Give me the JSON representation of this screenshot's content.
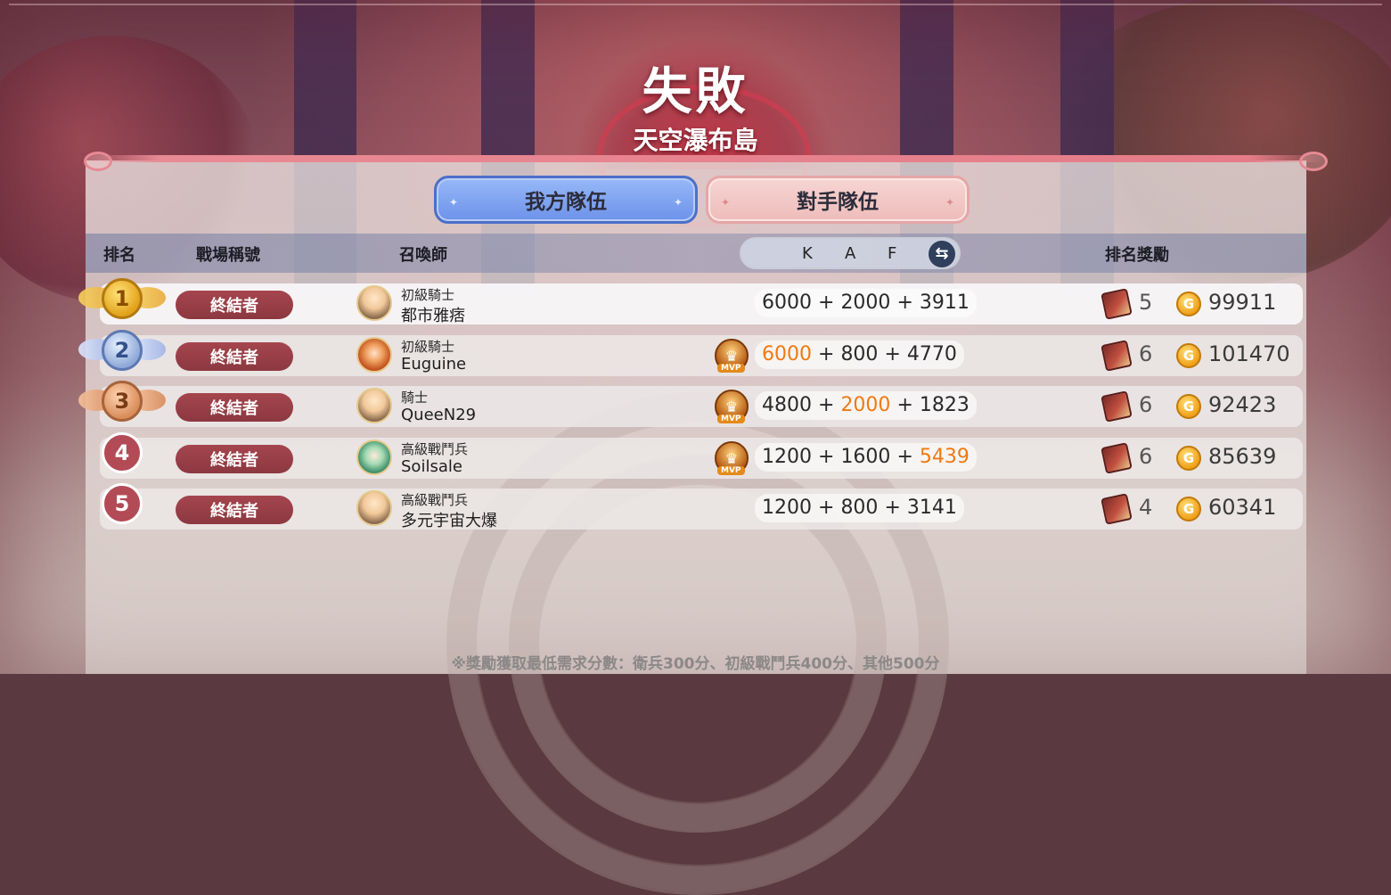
{
  "header": {
    "result": "失敗",
    "map_name": "天空瀑布島"
  },
  "tabs": {
    "ours": "我方隊伍",
    "theirs": "對手隊伍"
  },
  "columns": {
    "rank": "排名",
    "battle_title": "戰場稱號",
    "summoner": "召喚師",
    "k": "K",
    "a": "A",
    "f": "F",
    "reward": "排名獎勵"
  },
  "rows": [
    {
      "rank": "1",
      "title": "終結者",
      "class": "初級騎士",
      "name": "都市雅痞",
      "k": "6000",
      "a": "2000",
      "f": "3911",
      "mvp": false,
      "chest": "5",
      "coins": "99911"
    },
    {
      "rank": "2",
      "title": "終結者",
      "class": "初級騎士",
      "name": "Euguine",
      "k": "6000",
      "a": "800",
      "f": "4770",
      "mvp": true,
      "chest": "6",
      "coins": "101470"
    },
    {
      "rank": "3",
      "title": "終結者",
      "class": "騎士",
      "name": "QueeN29",
      "k": "4800",
      "a": "2000",
      "f": "1823",
      "mvp": true,
      "chest": "6",
      "coins": "92423"
    },
    {
      "rank": "4",
      "title": "終結者",
      "class": "高級戰鬥兵",
      "name": "Soilsale",
      "k": "1200",
      "a": "1600",
      "f": "5439",
      "mvp": true,
      "chest": "6",
      "coins": "85639"
    },
    {
      "rank": "5",
      "title": "終結者",
      "class": "高級戰鬥兵",
      "name": "多元宇宙大爆",
      "k": "1200",
      "a": "800",
      "f": "3141",
      "mvp": false,
      "chest": "4",
      "coins": "60341"
    }
  ],
  "mvp_label": "MVP",
  "plus": "+",
  "footnote": "※獎勵獲取最低需求分數：衛兵300分、初級戰鬥兵400分、其他500分",
  "colors": {
    "highlight": "#f07a10",
    "ours_tab": "#7a9ef0",
    "theirs_tab": "#f2c6c4",
    "title_pill": "#9a3f48"
  },
  "icons": {
    "swap": "swap-arrows-icon",
    "chest": "reward-chest-icon",
    "coin": "gold-coin-icon"
  }
}
